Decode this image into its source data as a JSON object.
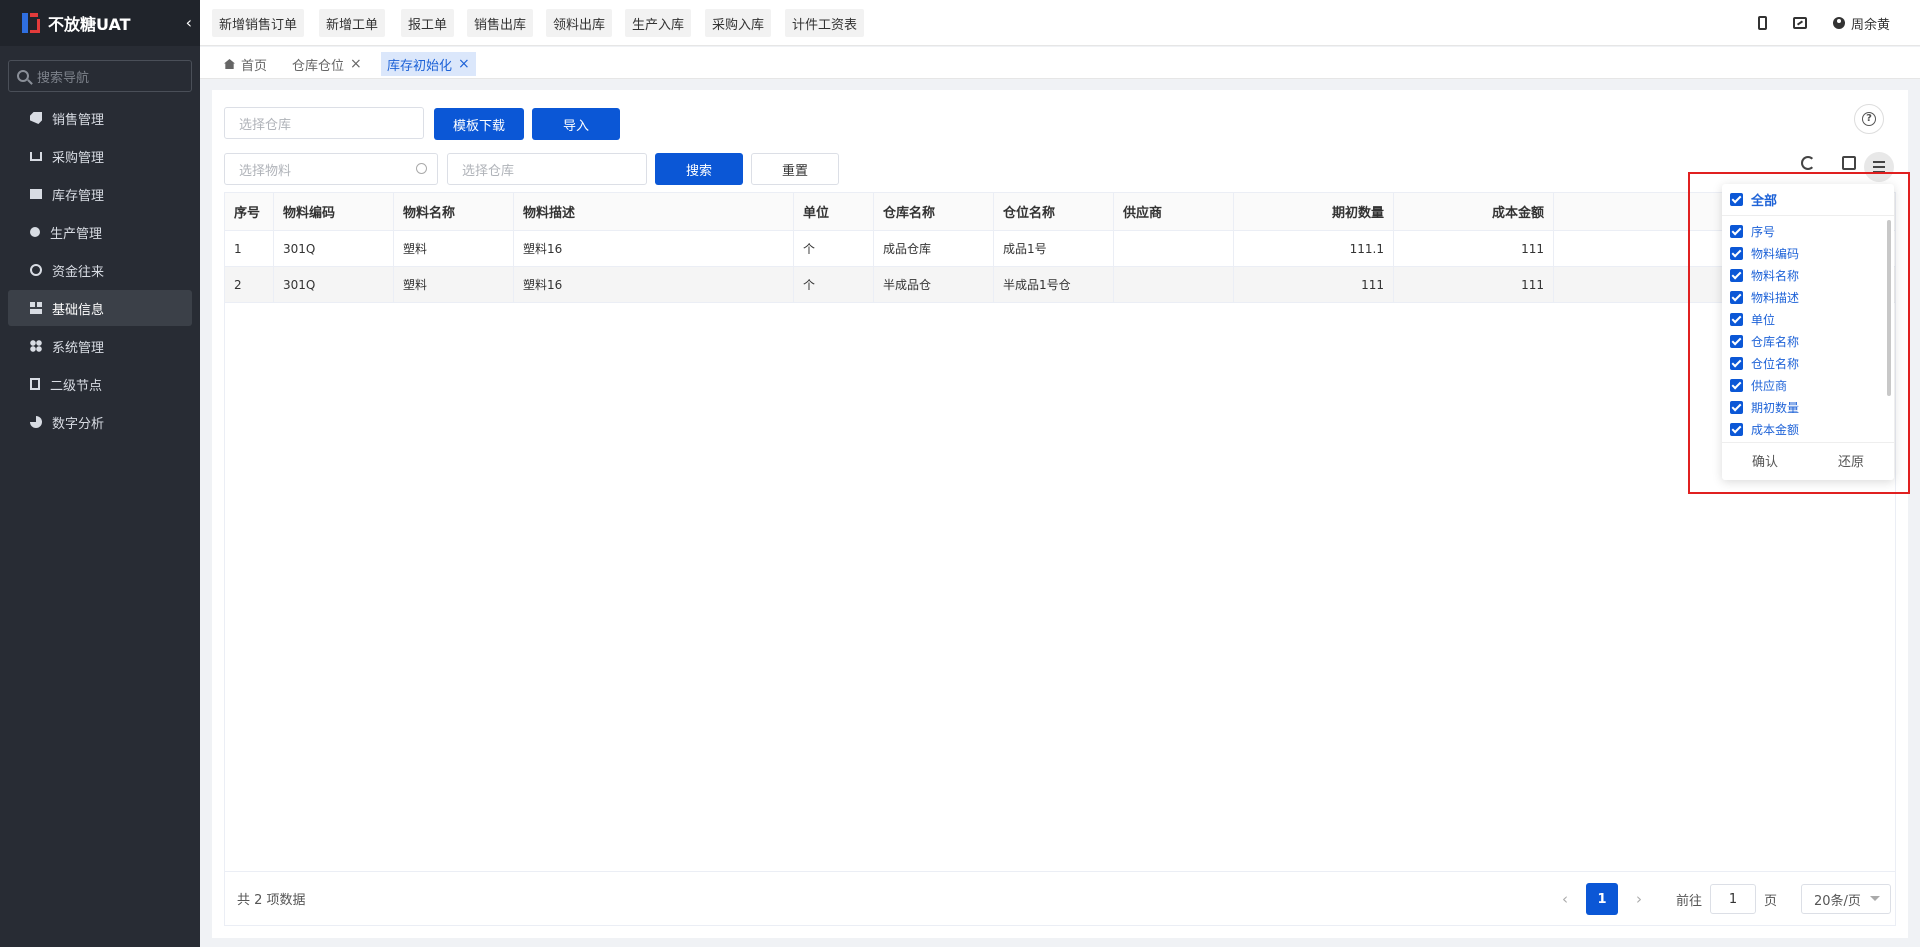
{
  "app": {
    "title": "不放糖UAT"
  },
  "nav": {
    "search_placeholder": "搜索导航",
    "items": [
      {
        "label": "销售管理",
        "icon": "tag-icon",
        "active": false
      },
      {
        "label": "采购管理",
        "icon": "cart-icon",
        "active": false
      },
      {
        "label": "库存管理",
        "icon": "box-icon",
        "active": false
      },
      {
        "label": "生产管理",
        "icon": "node-icon",
        "active": false
      },
      {
        "label": "资金往来",
        "icon": "coin-icon",
        "active": false
      },
      {
        "label": "基础信息",
        "icon": "grid-icon",
        "active": true
      },
      {
        "label": "系统管理",
        "icon": "dots-icon",
        "active": false
      },
      {
        "label": "二级节点",
        "icon": "doc-icon",
        "active": false
      },
      {
        "label": "数字分析",
        "icon": "pie-icon",
        "active": false
      }
    ]
  },
  "quick_actions": [
    "新增销售订单",
    "新增工单",
    "报工单",
    "销售出库",
    "领料出库",
    "生产入库",
    "采购入库",
    "计件工资表"
  ],
  "user": {
    "name": "周余黄"
  },
  "tabs": [
    {
      "label": "首页"
    },
    {
      "label": "仓库仓位"
    },
    {
      "label": "库存初始化"
    }
  ],
  "filters": {
    "warehouse_top_placeholder": "选择仓库",
    "material_placeholder": "选择物料",
    "warehouse_placeholder": "选择仓库",
    "template_button": "模板下载",
    "import_button": "导入",
    "search_button": "搜索",
    "reset_button": "重置"
  },
  "table": {
    "columns": [
      "序号",
      "物料编码",
      "物料名称",
      "物料描述",
      "单位",
      "仓库名称",
      "仓位名称",
      "供应商",
      "期初数量",
      "成本金额"
    ],
    "rows": [
      [
        "1",
        "301Q",
        "塑料",
        "塑料16",
        "个",
        "成品仓库",
        "成品1号",
        "",
        "111.1",
        "111"
      ],
      [
        "2",
        "301Q",
        "塑料",
        "塑料16",
        "个",
        "半成品仓",
        "半成品1号仓",
        "",
        "111",
        "111"
      ]
    ]
  },
  "pagination": {
    "total_text": "共 2 项数据",
    "current_page": "1",
    "goto_label": "前往",
    "goto_value": "1",
    "page_unit": "页",
    "page_size": "20条/页"
  },
  "column_popup": {
    "all_label": "全部",
    "items": [
      "序号",
      "物料编码",
      "物料名称",
      "物料描述",
      "单位",
      "仓库名称",
      "仓位名称",
      "供应商",
      "期初数量",
      "成本金额"
    ],
    "confirm": "确认",
    "restore": "还原"
  },
  "colors": {
    "primary": "#0b57d6",
    "sidebar_bg": "#282c34",
    "highlight": "#e02020"
  }
}
